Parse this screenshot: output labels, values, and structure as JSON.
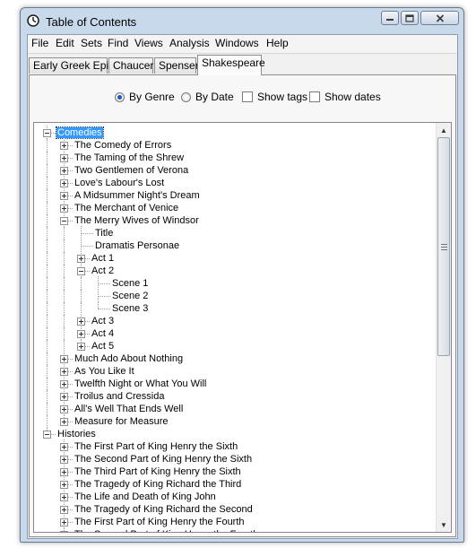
{
  "window": {
    "title": "Table of Contents"
  },
  "menu": [
    "File",
    "Edit",
    "Sets",
    "Find",
    "Views",
    "Analysis",
    "Windows",
    "Help"
  ],
  "tabs": [
    {
      "label": "Early Greek Epic",
      "active": false
    },
    {
      "label": "Chaucer",
      "active": false
    },
    {
      "label": "Spenser",
      "active": false
    },
    {
      "label": "Shakespeare",
      "active": true
    }
  ],
  "options": {
    "by_genre": {
      "label": "By Genre",
      "checked": true
    },
    "by_date": {
      "label": "By Date",
      "checked": false
    },
    "show_tags": {
      "label": "Show tags",
      "checked": false
    },
    "show_dates": {
      "label": "Show dates",
      "checked": false
    }
  },
  "tree": [
    {
      "label": "Comedies",
      "expanded": true,
      "selected": true,
      "children": [
        {
          "label": "The Comedy of Errors",
          "expanded": false
        },
        {
          "label": "The Taming of the Shrew",
          "expanded": false
        },
        {
          "label": "Two Gentlemen of Verona",
          "expanded": false
        },
        {
          "label": "Love's Labour's Lost",
          "expanded": false
        },
        {
          "label": "A Midsummer Night's Dream",
          "expanded": false
        },
        {
          "label": "The Merchant of Venice",
          "expanded": false
        },
        {
          "label": "The Merry Wives of Windsor",
          "expanded": true,
          "children": [
            {
              "label": "Title"
            },
            {
              "label": "Dramatis Personae"
            },
            {
              "label": "Act 1",
              "expanded": false
            },
            {
              "label": "Act 2",
              "expanded": true,
              "children": [
                {
                  "label": "Scene 1"
                },
                {
                  "label": "Scene 2"
                },
                {
                  "label": "Scene 3"
                }
              ]
            },
            {
              "label": "Act 3",
              "expanded": false
            },
            {
              "label": "Act 4",
              "expanded": false
            },
            {
              "label": "Act 5",
              "expanded": false
            }
          ]
        },
        {
          "label": "Much Ado About Nothing",
          "expanded": false
        },
        {
          "label": "As You Like It",
          "expanded": false
        },
        {
          "label": "Twelfth Night or What You Will",
          "expanded": false
        },
        {
          "label": "Troilus and Cressida",
          "expanded": false
        },
        {
          "label": "All's Well That Ends Well",
          "expanded": false
        },
        {
          "label": "Measure for Measure",
          "expanded": false
        }
      ]
    },
    {
      "label": "Histories",
      "expanded": true,
      "children": [
        {
          "label": "The First Part of King Henry the Sixth",
          "expanded": false
        },
        {
          "label": "The Second Part of King Henry the Sixth",
          "expanded": false
        },
        {
          "label": "The Third Part of King Henry the Sixth",
          "expanded": false
        },
        {
          "label": "The Tragedy of King Richard the Third",
          "expanded": false
        },
        {
          "label": "The Life and Death of King John",
          "expanded": false
        },
        {
          "label": "The Tragedy of King Richard the Second",
          "expanded": false
        },
        {
          "label": "The First Part of King Henry the Fourth",
          "expanded": false
        },
        {
          "label": "The Second Part of King Henry the Fourth",
          "expanded": false
        }
      ]
    }
  ],
  "icons": {
    "app": "clock-icon",
    "minimize": "minimize-icon",
    "maximize": "maximize-icon",
    "close": "close-icon",
    "scroll_up": "scroll-up-icon",
    "scroll_down": "scroll-down-icon"
  },
  "colors": {
    "selection": "#3399ff",
    "title_bar": "#c9d9ec",
    "radio_dot": "#1f55b8"
  }
}
